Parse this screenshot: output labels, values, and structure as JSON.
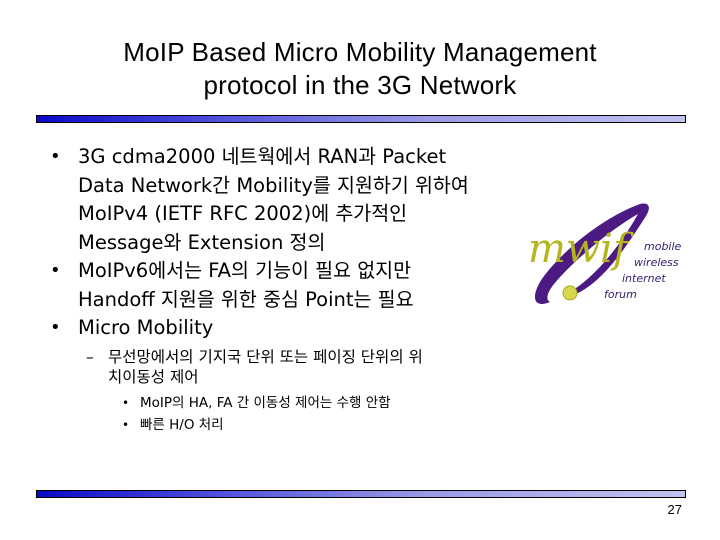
{
  "slide": {
    "title_line1": "MoIP Based Micro Mobility Management",
    "title_line2": "protocol in the 3G Network",
    "page_number": "27",
    "accent_gradient": [
      "#0a0ac8",
      "#c2c2f0"
    ]
  },
  "bullets": [
    {
      "lines": [
        "3G cdma2000 네트웍에서 RAN과 Packet",
        "Data Network간 Mobility를 지원하기 위하여",
        "MoIPv4 (IETF RFC 2002)에 추가적인",
        "Message와 Extension 정의"
      ]
    },
    {
      "lines": [
        "MoIPv6에서는 FA의 기능이 필요 없지만",
        "Handoff 지원을 위한 중심 Point는 필요"
      ]
    },
    {
      "lines": [
        "Micro Mobility"
      ],
      "sub": {
        "lines": [
          "무선망에서의 기지국 단위 또는  페이징 단위의 위",
          "치이동성 제어"
        ],
        "items": [
          "MoIP의 HA, FA 간 이동성 제어는 수행 안함",
          "빠른 H/O 처리"
        ]
      }
    }
  ],
  "logo": {
    "wordmark": "mwif",
    "tagline": [
      "mobile",
      "wireless",
      "internet",
      "forum"
    ],
    "wordmark_color": "#b5b520",
    "swoosh_color": "#4b1a82"
  },
  "glyphs": {
    "bullet": "•",
    "dash": "–"
  }
}
